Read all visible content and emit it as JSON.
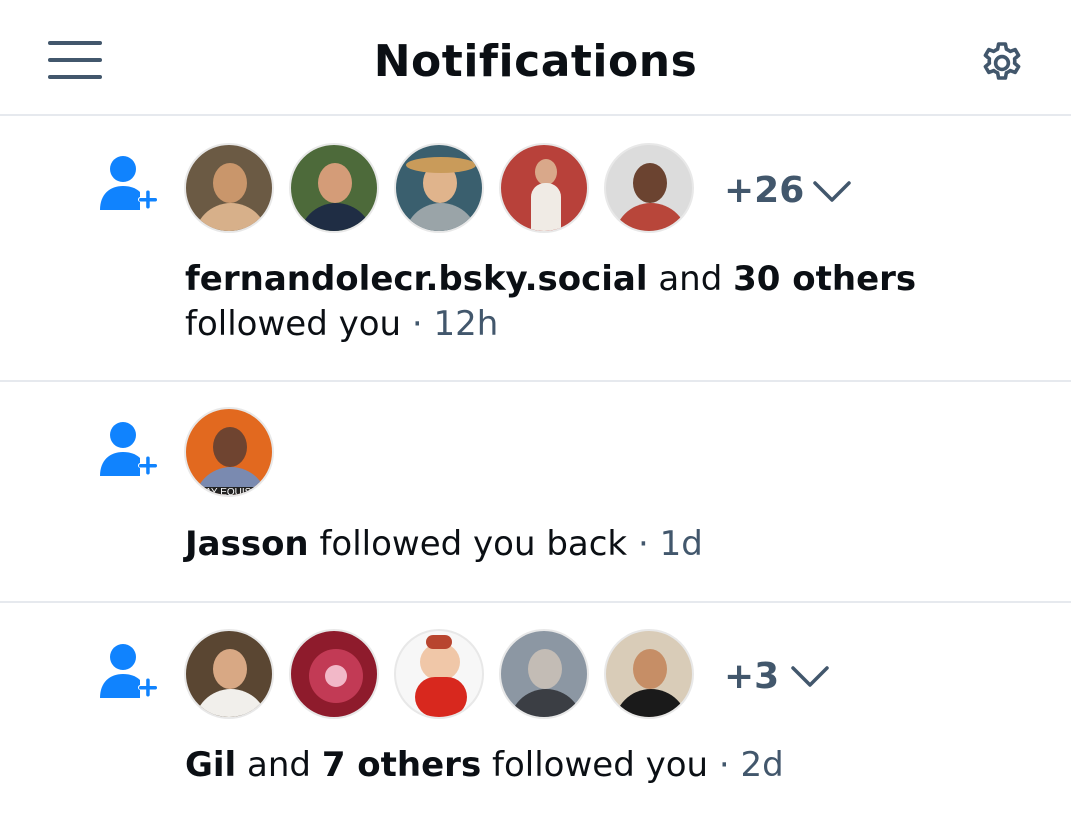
{
  "header": {
    "title": "Notifications"
  },
  "notifications": [
    {
      "type": "follow",
      "extra_count": "+26",
      "actor": "fernandolecr.bsky.social",
      "connector": "and",
      "others": "30 others",
      "action": "followed you",
      "separator": "·",
      "time": "12h"
    },
    {
      "type": "follow-back",
      "avatar_caption": "AY EQUIS",
      "actor": "Jasson",
      "action": "followed you back",
      "separator": "·",
      "time": "1d"
    },
    {
      "type": "follow",
      "extra_count": "+3",
      "actor": "Gil",
      "connector": "and",
      "others": "7 others",
      "action": "followed you",
      "separator": "·",
      "time": "2d"
    }
  ],
  "colors": {
    "accent": "#1083fe",
    "muted": "#42576c",
    "divider": "#e6e9ee"
  },
  "icons": {
    "menu": "hamburger-menu-icon",
    "settings": "gear-icon",
    "follow": "person-plus-icon",
    "expand": "chevron-down-icon"
  }
}
